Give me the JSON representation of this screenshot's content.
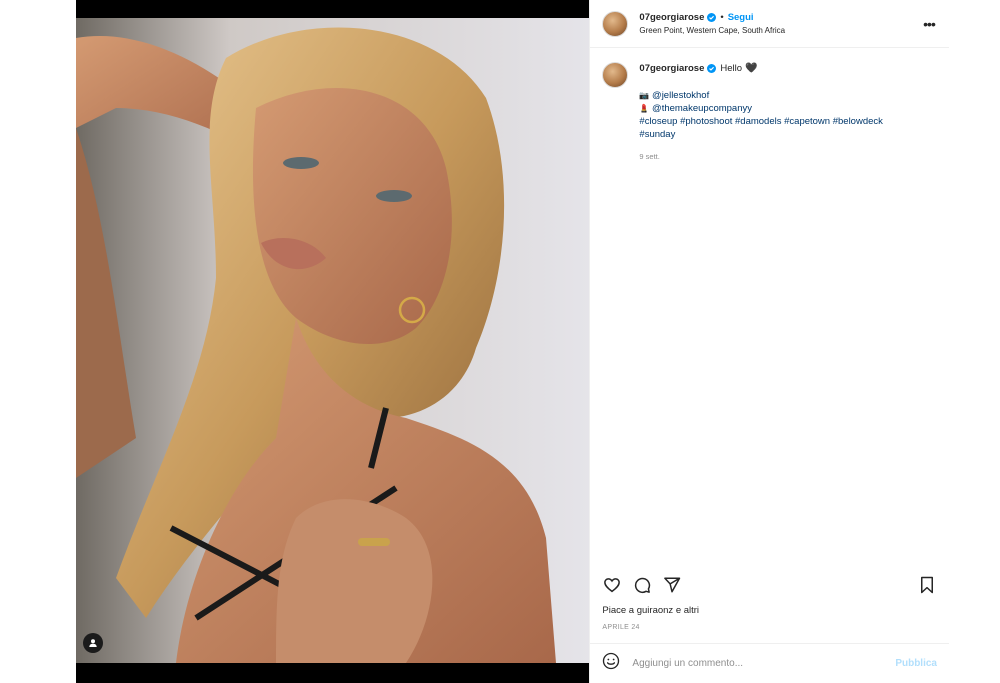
{
  "post": {
    "username": "07georgiarose",
    "follow_label": "Segui",
    "separator": "•",
    "location": "Green Point, Western Cape, South Africa",
    "more_icon": "more-horizontal-icon"
  },
  "caption": {
    "username": "07georgiarose",
    "text": "Hello",
    "heart": "🖤",
    "credits": [
      {
        "emoji": "📷",
        "handle": "@jellestokhof"
      },
      {
        "emoji": "💄",
        "handle": "@themakeupcompanyy"
      }
    ],
    "hashtags_line1": "#closeup #photoshoot #damodels #capetown #belowdeck",
    "hashtags_line2": "#sunday",
    "time": "9 sett."
  },
  "actions": {
    "like_icon": "heart-icon",
    "comment_icon": "comment-icon",
    "share_icon": "send-icon",
    "save_icon": "bookmark-icon"
  },
  "likes_text": "Piace a guiraonz e altri",
  "date": "APRILE 24",
  "comment": {
    "placeholder": "Aggiungi un commento...",
    "publish_label": "Pubblica"
  },
  "colors": {
    "accent": "#0095f6",
    "link": "#00376b",
    "publish_disabled": "#b2dffc"
  }
}
